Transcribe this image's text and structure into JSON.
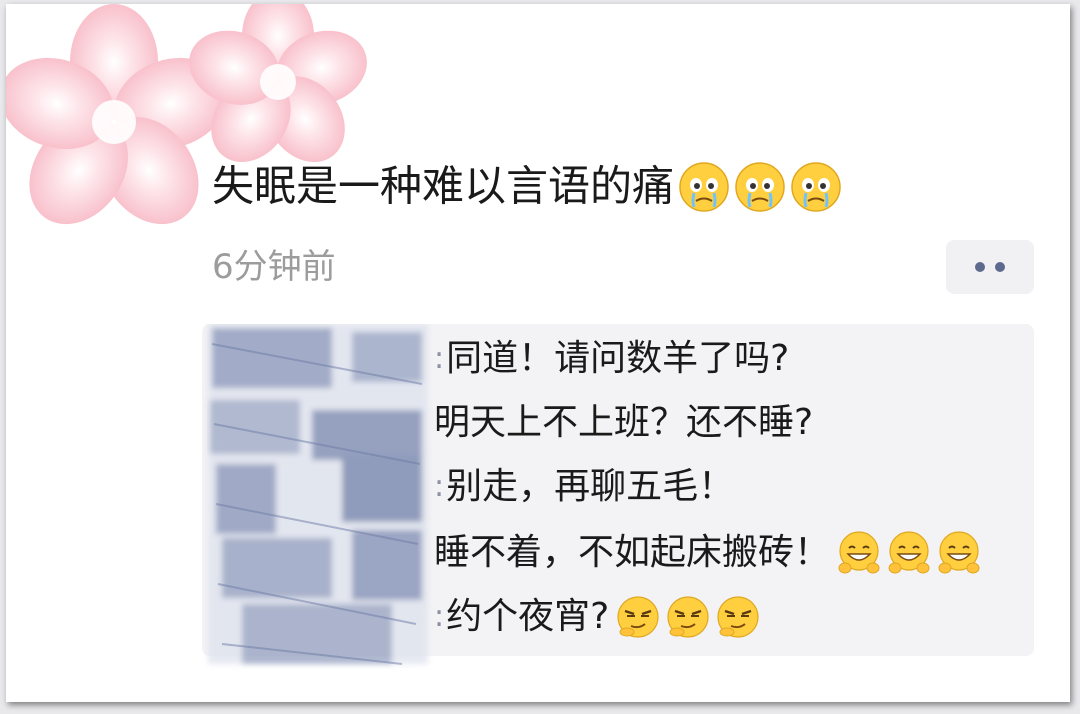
{
  "post": {
    "text": "失眠是一种难以言语的痛",
    "emojis": [
      "crying-face-icon",
      "crying-face-icon",
      "crying-face-icon"
    ],
    "timestamp": "6分钟前"
  },
  "comments": [
    {
      "text": "同道！请问数羊了吗?",
      "emojis": []
    },
    {
      "text": "明天上不上班？还不睡?",
      "emojis": []
    },
    {
      "text": "别走，再聊五毛！",
      "emojis": []
    },
    {
      "text": "睡不着，不如起床搬砖！",
      "emojis": [
        "peace-grin-icon",
        "peace-grin-icon",
        "peace-grin-icon"
      ]
    },
    {
      "text": "约个夜宵?",
      "emojis": [
        "smirk-face-icon",
        "smirk-face-icon",
        "smirk-face-icon"
      ]
    }
  ],
  "colors": {
    "flower_pink": "#f9c6cf",
    "link_blue": "#576b95",
    "comment_bg": "#f3f3f5",
    "time_gray": "#9c9c9c"
  }
}
